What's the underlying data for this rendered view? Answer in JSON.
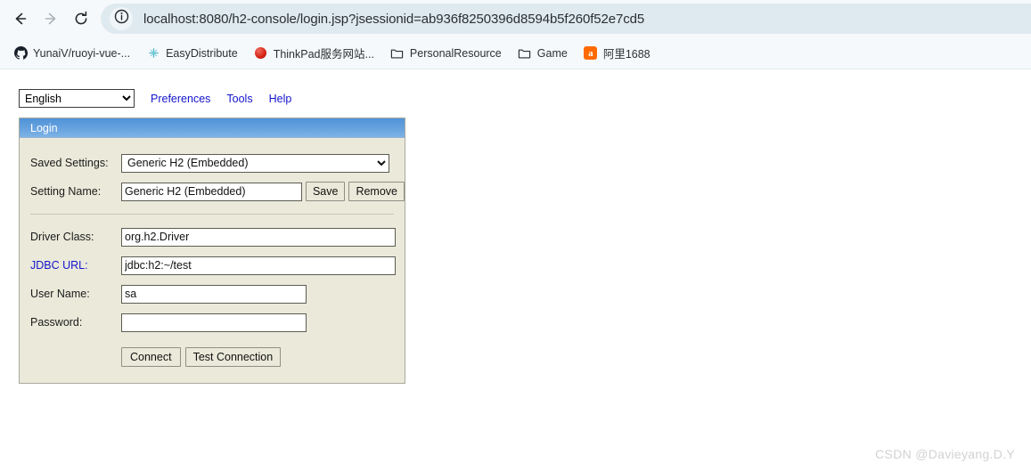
{
  "browser": {
    "nav": {
      "back_icon": "arrow-left-icon",
      "forward_icon": "arrow-right-icon",
      "reload_icon": "reload-icon"
    },
    "omnibox": {
      "site_info_icon": "info-circle-icon",
      "url": "localhost:8080/h2-console/login.jsp?jsessionid=ab936f8250396d8594b5f260f52e7cd5"
    },
    "bookmarks": [
      {
        "label": "YunaiV/ruoyi-vue-...",
        "icon": "github-icon"
      },
      {
        "label": "EasyDistribute",
        "icon": "sparkle-icon"
      },
      {
        "label": "ThinkPad服务网站...",
        "icon": "red-dot-icon"
      },
      {
        "label": "PersonalResource",
        "icon": "folder-icon"
      },
      {
        "label": "Game",
        "icon": "folder-icon"
      },
      {
        "label": "阿里1688",
        "icon": "alibaba-icon"
      }
    ]
  },
  "page": {
    "toolbar": {
      "language_value": "English",
      "language_options": [
        "English"
      ],
      "links": [
        {
          "label": "Preferences"
        },
        {
          "label": "Tools"
        },
        {
          "label": "Help"
        }
      ]
    },
    "login_panel": {
      "title": "Login",
      "saved_settings": {
        "label": "Saved Settings:",
        "value": "Generic H2 (Embedded)",
        "options": [
          "Generic H2 (Embedded)"
        ]
      },
      "setting_name": {
        "label": "Setting Name:",
        "value": "Generic H2 (Embedded)",
        "save_label": "Save",
        "remove_label": "Remove"
      },
      "driver_class": {
        "label": "Driver Class:",
        "value": "org.h2.Driver"
      },
      "jdbc_url": {
        "label": "JDBC URL:",
        "value": "jdbc:h2:~/test"
      },
      "user_name": {
        "label": "User Name:",
        "value": "sa"
      },
      "password": {
        "label": "Password:",
        "value": "",
        "placeholder": ""
      },
      "actions": {
        "connect_label": "Connect",
        "test_connection_label": "Test Connection"
      }
    }
  },
  "watermark": "CSDN @Davieyang.D.Y",
  "colors": {
    "panel_header_blue": "#639fdd",
    "panel_bg": "#eae9da",
    "link_blue": "#1414cc",
    "omnibox_bg": "#dfeaf0",
    "chrome_bg": "#f6f9fb"
  }
}
